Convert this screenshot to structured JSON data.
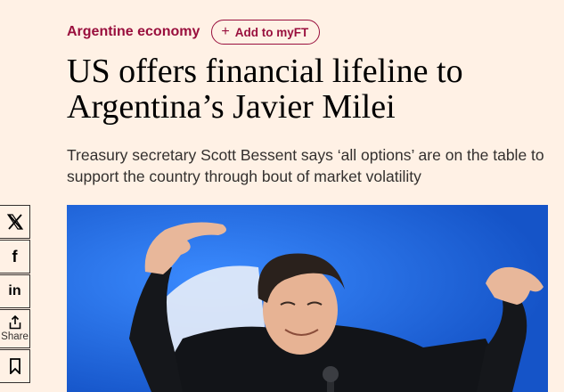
{
  "topic": {
    "label": "Argentine economy"
  },
  "myft": {
    "label": "Add to myFT"
  },
  "article": {
    "headline": "US offers financial lifeline to Argentina’s Javier Milei",
    "standfirst": "Treasury secretary Scott Bessent says ‘all options’ are on the table to support the country through bout of market volatility"
  },
  "share": {
    "x_icon": "x-icon",
    "facebook_icon": "facebook-icon",
    "linkedin_icon": "linkedin-icon",
    "share_icon": "share-icon",
    "share_label": "Share",
    "bookmark_icon": "bookmark-icon"
  },
  "colors": {
    "background": "#fff1e5",
    "accent": "#990f3d",
    "text": "#33302e",
    "headline": "#000000",
    "image_blue": "#1e6ae6"
  }
}
